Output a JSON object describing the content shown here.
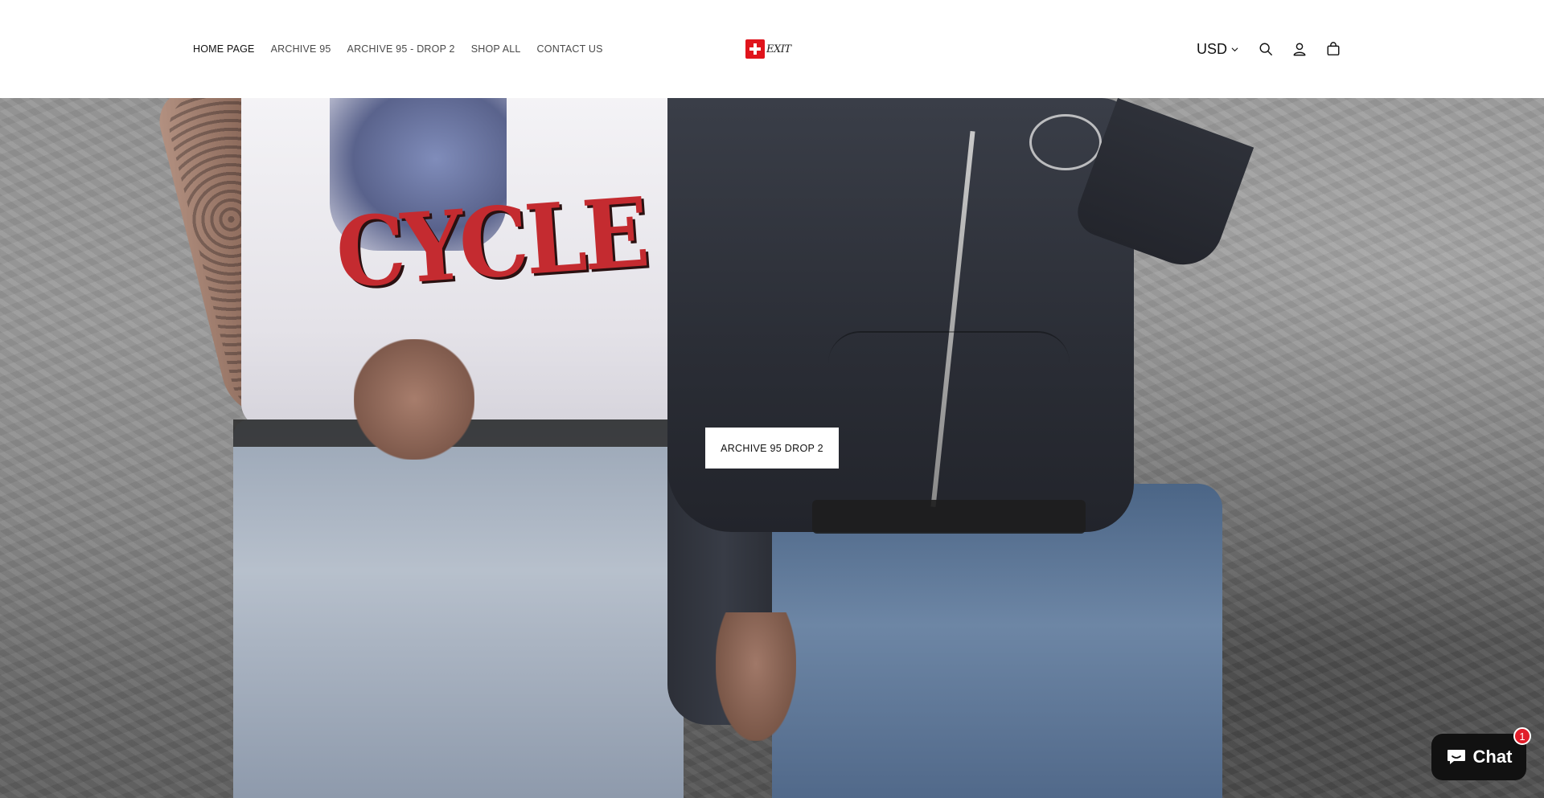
{
  "header": {
    "nav": [
      {
        "label": "HOME PAGE",
        "active": true
      },
      {
        "label": "ARCHIVE 95",
        "active": false
      },
      {
        "label": "ARCHIVE 95 - DROP 2",
        "active": false
      },
      {
        "label": "SHOP ALL",
        "active": false
      },
      {
        "label": "CONTACT US",
        "active": false
      }
    ],
    "logo": {
      "text": "EXIT",
      "icon": "swiss-cross-flag"
    },
    "currency": {
      "selected": "USD"
    },
    "icons": [
      "search-icon",
      "account-icon",
      "cart-icon"
    ]
  },
  "hero": {
    "button_label": "ARCHIVE 95 DROP 2",
    "shirt_print_text": "CYCLE"
  },
  "chat_widget": {
    "label": "Chat",
    "badge_count": "1"
  },
  "colors": {
    "badge_red": "#e11d2a",
    "chat_bg": "#111111",
    "logo_red": "#e0141c"
  }
}
